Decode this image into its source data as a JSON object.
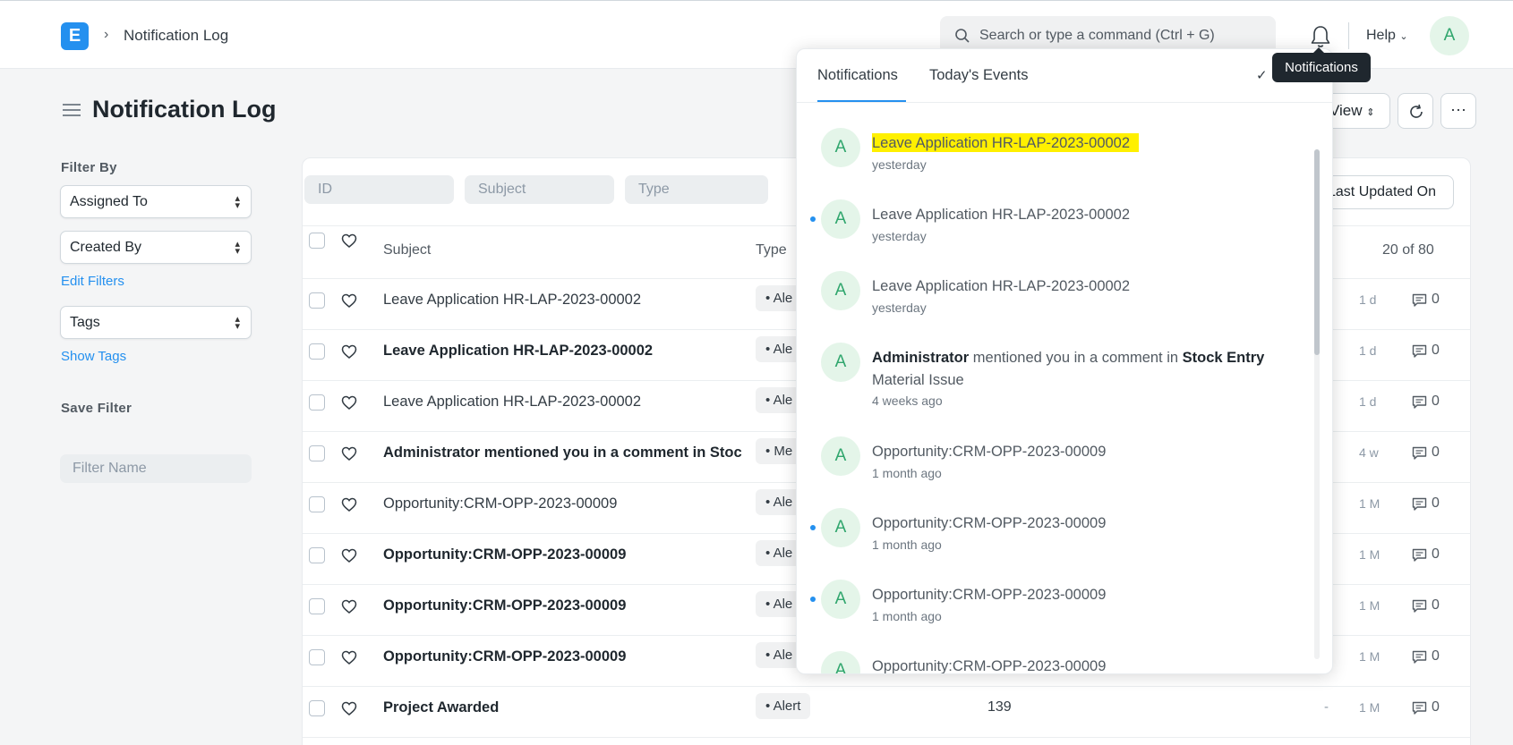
{
  "navbar": {
    "logo_letter": "E",
    "breadcrumb": "Notification Log",
    "search_placeholder": "Search or type a command (Ctrl + G)",
    "help_label": "Help",
    "avatar_letter": "A"
  },
  "page": {
    "title": "Notification Log",
    "view_label": "View",
    "more_label": "···"
  },
  "sidebar": {
    "filter_by": "Filter By",
    "assigned_to": "Assigned To",
    "created_by": "Created By",
    "edit_filters": "Edit Filters",
    "tags": "Tags",
    "show_tags": "Show Tags",
    "save_filter": "Save Filter",
    "filter_name_placeholder": "Filter Name"
  },
  "list": {
    "filters": {
      "id": "ID",
      "subject": "Subject",
      "type": "Type"
    },
    "sort_label": "Last Updated On",
    "header": {
      "subject": "Subject",
      "type": "Type",
      "count": "20 of 80"
    },
    "rows": [
      {
        "subject": "Leave Application HR-LAP-2023-00002",
        "bold": false,
        "type": "• Ale",
        "num": "",
        "dash": "",
        "time": "1 d",
        "comments": "0"
      },
      {
        "subject": "Leave Application HR-LAP-2023-00002",
        "bold": true,
        "type": "• Ale",
        "num": "",
        "dash": "",
        "time": "1 d",
        "comments": "0"
      },
      {
        "subject": "Leave Application HR-LAP-2023-00002",
        "bold": false,
        "type": "• Ale",
        "num": "",
        "dash": "",
        "time": "1 d",
        "comments": "0"
      },
      {
        "subject": "Administrator mentioned you in a comment in Stoc",
        "bold": true,
        "type": "• Me",
        "num": "",
        "dash": "",
        "time": "4 w",
        "comments": "0"
      },
      {
        "subject": "Opportunity:CRM-OPP-2023-00009",
        "bold": false,
        "type": "• Ale",
        "num": "",
        "dash": "",
        "time": "1 M",
        "comments": "0"
      },
      {
        "subject": "Opportunity:CRM-OPP-2023-00009",
        "bold": true,
        "type": "• Ale",
        "num": "",
        "dash": "",
        "time": "1 M",
        "comments": "0"
      },
      {
        "subject": "Opportunity:CRM-OPP-2023-00009",
        "bold": true,
        "type": "• Ale",
        "num": "",
        "dash": "",
        "time": "1 M",
        "comments": "0"
      },
      {
        "subject": "Opportunity:CRM-OPP-2023-00009",
        "bold": true,
        "type": "• Ale",
        "num": "",
        "dash": "",
        "time": "1 M",
        "comments": "0"
      },
      {
        "subject": "Project Awarded",
        "bold": true,
        "type": "• Alert",
        "num": "139",
        "dash": "-",
        "time": "1 M",
        "comments": "0"
      }
    ]
  },
  "notifications": {
    "tab_notifications": "Notifications",
    "tab_events": "Today's Events",
    "mark_read": "✓",
    "tooltip": "Notifications",
    "items": [
      {
        "avatar": "A",
        "title": "Leave Application HR-LAP-2023-00002",
        "time": "yesterday",
        "unread": false,
        "highlight": true
      },
      {
        "avatar": "A",
        "title": "Leave Application HR-LAP-2023-00002",
        "time": "yesterday",
        "unread": true,
        "highlight": false
      },
      {
        "avatar": "A",
        "title": "Leave Application HR-LAP-2023-00002",
        "time": "yesterday",
        "unread": false,
        "highlight": false
      },
      {
        "avatar": "A",
        "title_parts": [
          "Administrator",
          " mentioned you in a comment in ",
          "Stock Entry",
          " Material Issue"
        ],
        "time": "4 weeks ago",
        "unread": false,
        "highlight": false
      },
      {
        "avatar": "A",
        "title": "Opportunity:CRM-OPP-2023-00009",
        "time": "1 month ago",
        "unread": false,
        "highlight": false
      },
      {
        "avatar": "A",
        "title": "Opportunity:CRM-OPP-2023-00009",
        "time": "1 month ago",
        "unread": true,
        "highlight": false
      },
      {
        "avatar": "A",
        "title": "Opportunity:CRM-OPP-2023-00009",
        "time": "1 month ago",
        "unread": true,
        "highlight": false
      },
      {
        "avatar": "A",
        "title": "Opportunity:CRM-OPP-2023-00009",
        "time": "",
        "unread": false,
        "highlight": false
      }
    ]
  }
}
